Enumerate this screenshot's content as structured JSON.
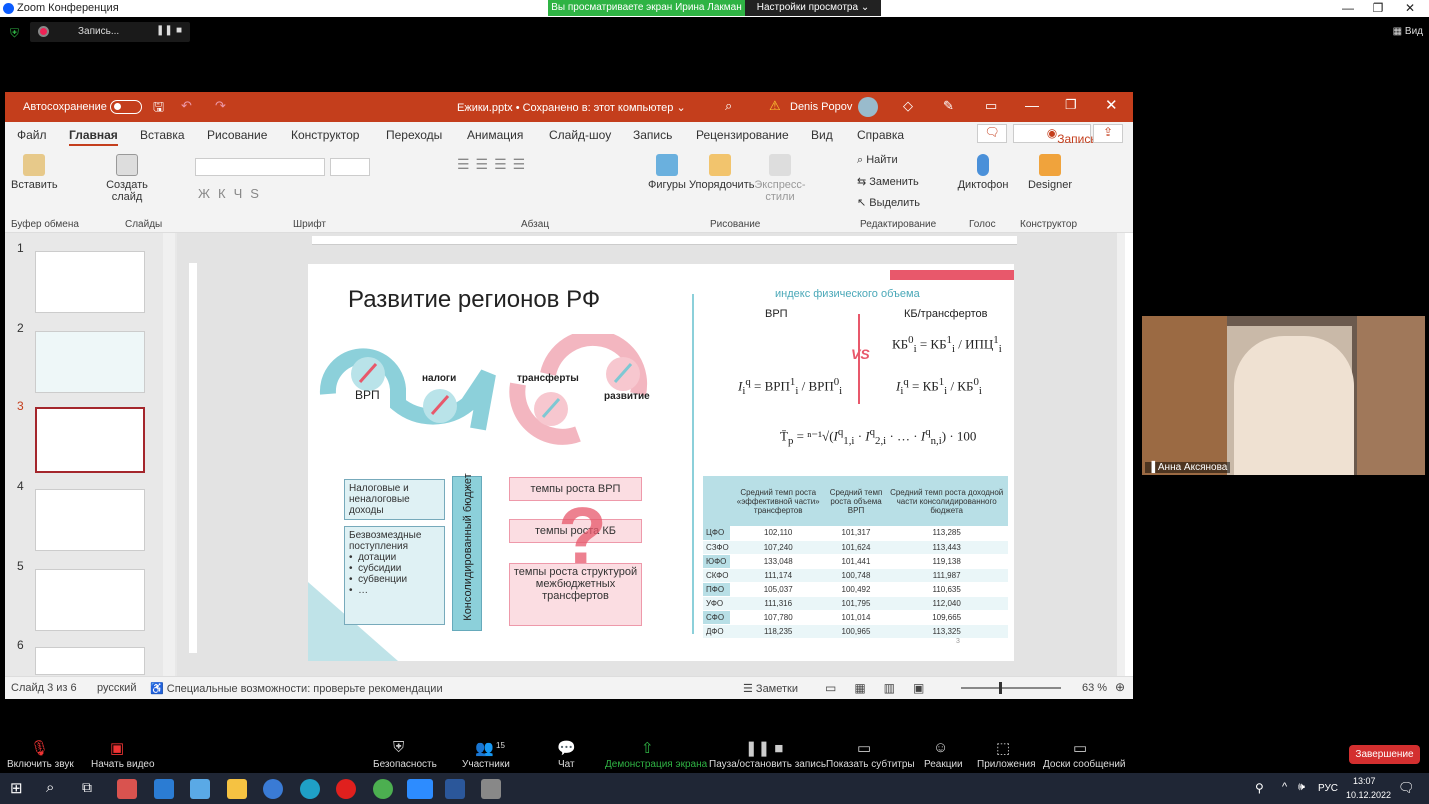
{
  "zoom": {
    "title": "Zoom Конференция",
    "banner_text": "Вы просматриваете экран Ирина Лакман",
    "view_settings": "Настройки просмотра",
    "recording": "Запись...",
    "view": "Вид",
    "participant_name": "Анна Аксянова",
    "participants_count": "15",
    "end_button": "Завершение",
    "toolbar": [
      "Включить звук",
      "Начать видео",
      "Безопасность",
      "Участники",
      "Чат",
      "Демонстрация экрана",
      "Пауза/остановить запись",
      "Показать субтитры",
      "Реакции",
      "Приложения",
      "Доски сообщений"
    ]
  },
  "ppt": {
    "autosave": "Автосохранение",
    "filename": "Ежики.pptx • Сохранено в: этот компьютер",
    "user": "Denis Popov",
    "menu": [
      "Файл",
      "Главная",
      "Вставка",
      "Рисование",
      "Конструктор",
      "Переходы",
      "Анимация",
      "Слайд-шоу",
      "Запись",
      "Рецензирование",
      "Вид",
      "Справка"
    ],
    "record_button": "Запись",
    "groups": [
      "Буфер обмена",
      "Слайды",
      "Шрифт",
      "Абзац",
      "Рисование",
      "Редактирование",
      "Голос",
      "Конструктор"
    ],
    "buttons": {
      "paste": "Вставить",
      "create_slide": "Создать слайд",
      "shapes": "Фигуры",
      "arrange": "Упорядочить",
      "express": "Экспресс-стили",
      "find": "Найти",
      "replace": "Заменить",
      "select": "Выделить",
      "dictophone": "Диктофон",
      "designer": "Designer"
    },
    "status": {
      "slide": "Слайд 3 из 6",
      "lang": "русский",
      "accessibility": "Специальные возможности: проверьте рекомендации",
      "notes": "Заметки",
      "zoom": "63 %"
    },
    "thumb_numbers": [
      "1",
      "2",
      "3",
      "4",
      "5",
      "6"
    ]
  },
  "slide": {
    "title": "Развитие регионов РФ",
    "vrp": "ВРП",
    "nalogi": "налоги",
    "transfery": "трансферты",
    "razvitie": "развитие",
    "box1": "Налоговые и неналоговые доходы",
    "box2_title": "Безвозмездные поступления",
    "box2_items": [
      "дотации",
      "субсидии",
      "субвенции",
      "…"
    ],
    "budget": "Консолидированный бюджет",
    "pink": [
      "темпы роста ВРП",
      "темпы роста КБ",
      "темпы роста структурой межбюджетных трансфертов"
    ],
    "index_title": "индекс физического объема",
    "col_vrp": "ВРП",
    "col_kb": "КБ/трансфертов",
    "vs": "VS",
    "page": "3",
    "table_headers": [
      "",
      "Средний темп роста «эффективной части» трансфертов",
      "Средний темп роста объема ВРП",
      "Средний темп роста доходной части консолидированного бюджета"
    ],
    "table_rows": [
      [
        "ЦФО",
        "102,110",
        "101,317",
        "113,285"
      ],
      [
        "СЗФО",
        "107,240",
        "101,624",
        "113,443"
      ],
      [
        "ЮФО",
        "133,048",
        "101,441",
        "119,138"
      ],
      [
        "СКФО",
        "111,174",
        "100,748",
        "111,987"
      ],
      [
        "ПФО",
        "105,037",
        "100,492",
        "110,635"
      ],
      [
        "УФО",
        "111,316",
        "101,795",
        "112,040"
      ],
      [
        "СФО",
        "107,780",
        "101,014",
        "109,665"
      ],
      [
        "ДФО",
        "118,235",
        "100,965",
        "113,325"
      ]
    ]
  },
  "taskbar": {
    "lang": "РУС",
    "time": "13:07",
    "date": "10.12.2022"
  },
  "colors": {
    "ppt_red": "#c43e1c",
    "teal": "#7ec8d3",
    "pink": "#e8586b",
    "zoom_green": "#2fb344"
  }
}
